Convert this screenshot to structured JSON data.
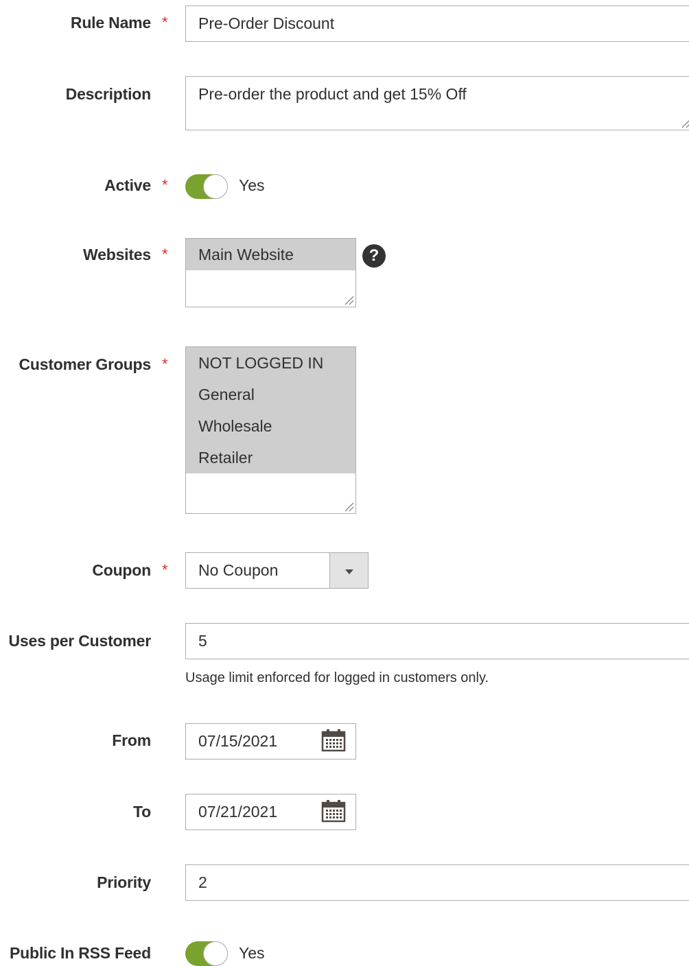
{
  "form": {
    "rule_name": {
      "label": "Rule Name",
      "required": "*",
      "value": "Pre-Order Discount"
    },
    "description": {
      "label": "Description",
      "value": "Pre-order the product and get 15% Off"
    },
    "active": {
      "label": "Active",
      "required": "*",
      "value": "Yes",
      "on": true
    },
    "websites": {
      "label": "Websites",
      "required": "*",
      "options": [
        "Main Website"
      ],
      "help_icon": "question-icon"
    },
    "customer_groups": {
      "label": "Customer Groups",
      "required": "*",
      "options": [
        "NOT LOGGED IN",
        "General",
        "Wholesale",
        "Retailer"
      ]
    },
    "coupon": {
      "label": "Coupon",
      "required": "*",
      "value": "No Coupon"
    },
    "uses_per_customer": {
      "label": "Uses per Customer",
      "value": "5",
      "note": "Usage limit enforced for logged in customers only."
    },
    "from": {
      "label": "From",
      "value": "07/15/2021",
      "icon": "calendar-icon"
    },
    "to": {
      "label": "To",
      "value": "07/21/2021",
      "icon": "calendar-icon"
    },
    "priority": {
      "label": "Priority",
      "value": "2"
    },
    "public_in_rss_feed": {
      "label": "Public In RSS Feed",
      "value": "Yes",
      "on": true
    }
  },
  "colors": {
    "toggle_on": "#79a22e",
    "required_star": "#e02b27",
    "selected_option": "#cecece"
  }
}
